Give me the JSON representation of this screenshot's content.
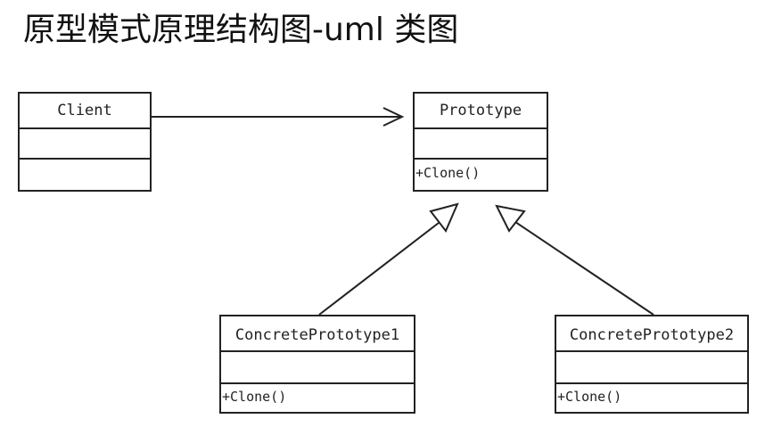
{
  "title": "原型模式原理结构图-uml 类图",
  "classes": {
    "client": {
      "name": "Client",
      "operations": ""
    },
    "prototype": {
      "name": "Prototype",
      "operations": "+Clone()"
    },
    "concrete1": {
      "name": "ConcretePrototype1",
      "operations": "+Clone()"
    },
    "concrete2": {
      "name": "ConcretePrototype2",
      "operations": "+Clone()"
    }
  },
  "relations": [
    {
      "type": "association",
      "from": "Client",
      "to": "Prototype"
    },
    {
      "type": "generalization",
      "from": "ConcretePrototype1",
      "to": "Prototype"
    },
    {
      "type": "generalization",
      "from": "ConcretePrototype2",
      "to": "Prototype"
    }
  ],
  "colors": {
    "line": "#222222",
    "background": "#ffffff"
  }
}
